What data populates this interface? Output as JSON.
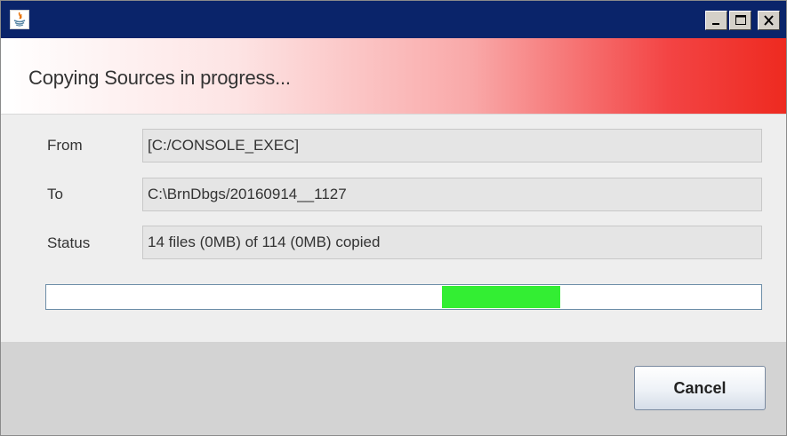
{
  "window": {
    "title": "",
    "controls": {
      "minimize_icon": "minimize-icon",
      "maximize_icon": "maximize-icon",
      "close_icon": "close-icon"
    }
  },
  "banner": {
    "title": "Copying Sources in progress..."
  },
  "form": {
    "from_label": "From",
    "from_value": "[C:/CONSOLE_EXEC]",
    "to_label": "To",
    "to_value": "C:\\BrnDbgs/20160914__1127",
    "status_label": "Status",
    "status_value": "14 files (0MB) of 114 (0MB) copied"
  },
  "progress": {
    "mode": "indeterminate",
    "bar_color": "#33ee33"
  },
  "footer": {
    "cancel_label": "Cancel"
  },
  "colors": {
    "titlebar": "#0a246a",
    "banner_accent": "#ee2a20",
    "progress_fill": "#33ee33"
  }
}
